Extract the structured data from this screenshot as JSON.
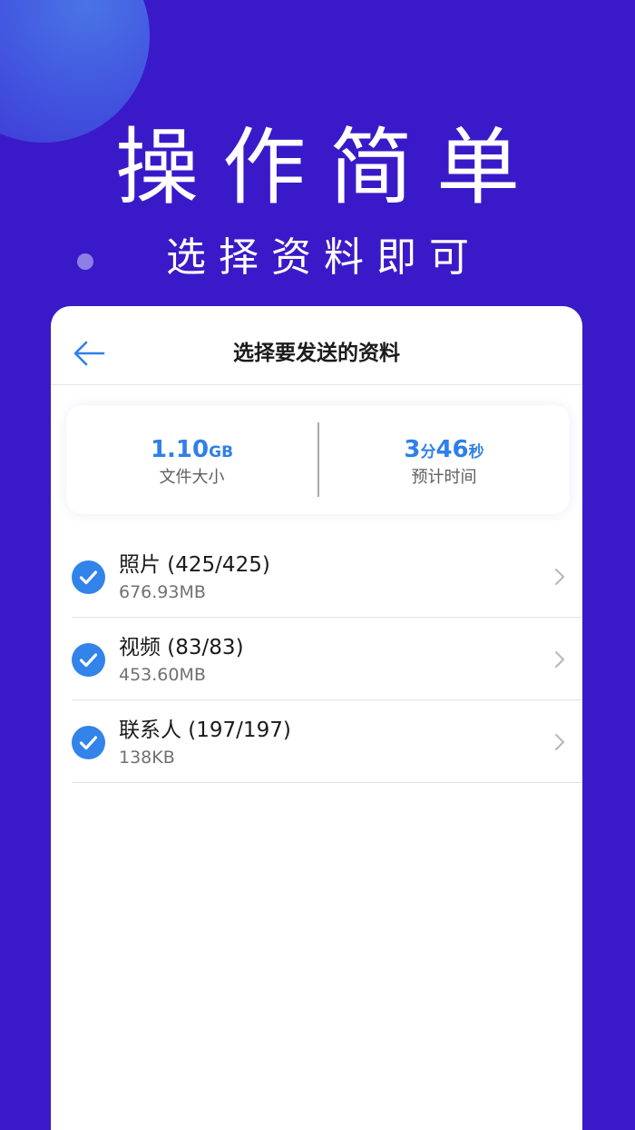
{
  "hero": {
    "title": "操作简单",
    "subtitle": "选择资料即可"
  },
  "nav": {
    "title": "选择要发送的资料",
    "back_icon": "arrow-left-icon"
  },
  "summary": {
    "size_value": "1.10",
    "size_unit": "GB",
    "size_label": "文件大小",
    "time_min": "3",
    "time_min_unit": "分",
    "time_sec": "46",
    "time_sec_unit": "秒",
    "time_label": "预计时间"
  },
  "items": [
    {
      "title": "照片 (425/425)",
      "size": "676.93MB",
      "checked": true
    },
    {
      "title": "视频 (83/83)",
      "size": "453.60MB",
      "checked": true
    },
    {
      "title": "联系人 (197/197)",
      "size": "138KB",
      "checked": true
    }
  ],
  "colors": {
    "background": "#3a1ac8",
    "accent": "#3283ea",
    "card": "#ffffff"
  }
}
